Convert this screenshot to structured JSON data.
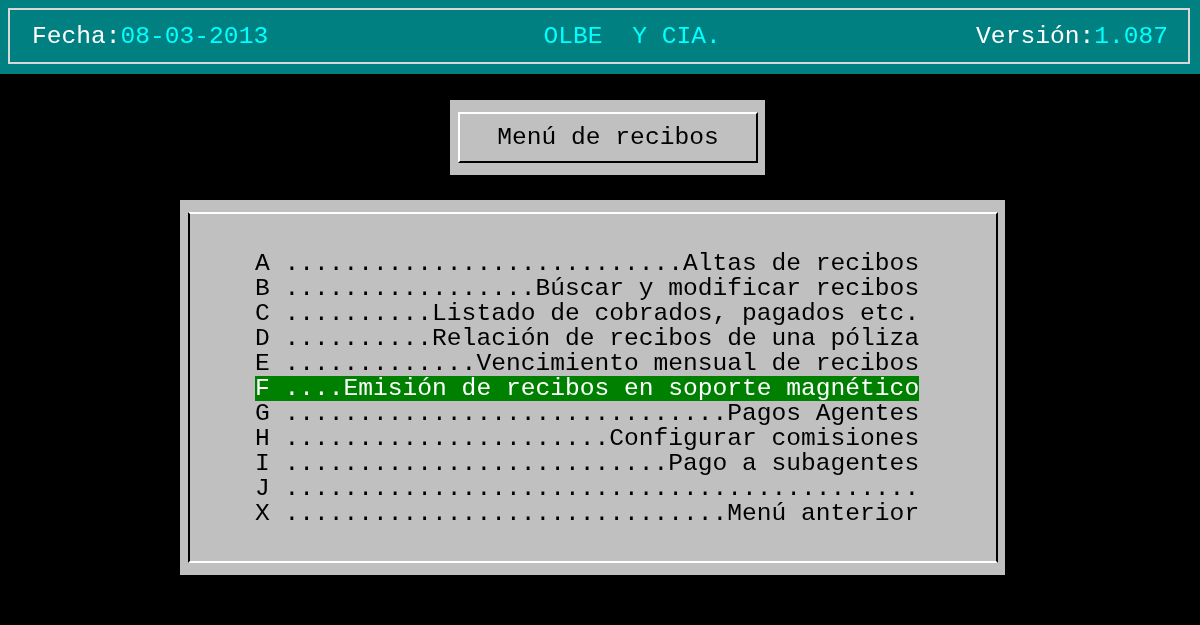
{
  "header": {
    "date_label": "Fecha:",
    "date_value": "08-03-2013",
    "company": "OLBE  Y CIA.",
    "version_label": "Versión:",
    "version_value": "1.087"
  },
  "title": "Menú de recibos",
  "items": [
    {
      "text": "A ...........................Altas de recibos",
      "selected": false
    },
    {
      "text": "B .................Búscar y modificar recibos",
      "selected": false
    },
    {
      "text": "C ..........Listado de cobrados, pagados etc.",
      "selected": false
    },
    {
      "text": "D ..........Relación de recibos de una póliza",
      "selected": false
    },
    {
      "text": "E .............Vencimiento mensual de recibos",
      "selected": false
    },
    {
      "text": "F ....Emisión de recibos en soporte magnético",
      "selected": true
    },
    {
      "text": "G ..............................Pagos Agentes",
      "selected": false
    },
    {
      "text": "H ......................Configurar comisiones",
      "selected": false
    },
    {
      "text": "I ..........................Pago a subagentes",
      "selected": false
    },
    {
      "text": "J ...........................................",
      "selected": false
    },
    {
      "text": "X ..............................Menú anterior",
      "selected": false
    }
  ]
}
